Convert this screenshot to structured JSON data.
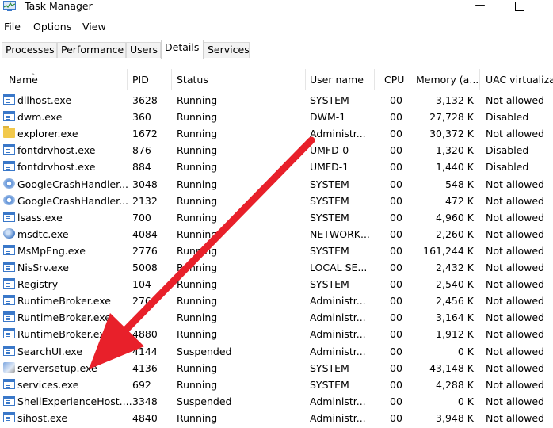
{
  "window": {
    "title": "Task Manager",
    "minimize_glyph": "—"
  },
  "menu": [
    "File",
    "Options",
    "View"
  ],
  "tabs": [
    "Processes",
    "Performance",
    "Users",
    "Details",
    "Services"
  ],
  "active_tab": "Details",
  "columns": {
    "name": "Name",
    "pid": "PID",
    "status": "Status",
    "user": "User name",
    "cpu": "CPU",
    "memory": "Memory (a...",
    "uac": "UAC virtualizat"
  },
  "rows": [
    {
      "icon": "window-icon",
      "name": "dllhost.exe",
      "pid": "3628",
      "status": "Running",
      "user": "SYSTEM",
      "cpu": "00",
      "memory": "3,132 K",
      "uac": "Not allowed"
    },
    {
      "icon": "window-icon",
      "name": "dwm.exe",
      "pid": "360",
      "status": "Running",
      "user": "DWM-1",
      "cpu": "00",
      "memory": "27,728 K",
      "uac": "Disabled"
    },
    {
      "icon": "folder-icon",
      "name": "explorer.exe",
      "pid": "1672",
      "status": "Running",
      "user": "Administr...",
      "cpu": "00",
      "memory": "30,372 K",
      "uac": "Not allowed"
    },
    {
      "icon": "window-icon",
      "name": "fontdrvhost.exe",
      "pid": "876",
      "status": "Running",
      "user": "UMFD-0",
      "cpu": "00",
      "memory": "1,320 K",
      "uac": "Disabled"
    },
    {
      "icon": "window-icon",
      "name": "fontdrvhost.exe",
      "pid": "884",
      "status": "Running",
      "user": "UMFD-1",
      "cpu": "00",
      "memory": "1,440 K",
      "uac": "Disabled"
    },
    {
      "icon": "gear-icon",
      "name": "GoogleCrashHandler...",
      "pid": "3048",
      "status": "Running",
      "user": "SYSTEM",
      "cpu": "00",
      "memory": "548 K",
      "uac": "Not allowed"
    },
    {
      "icon": "gear-icon",
      "name": "GoogleCrashHandler...",
      "pid": "2132",
      "status": "Running",
      "user": "SYSTEM",
      "cpu": "00",
      "memory": "472 K",
      "uac": "Not allowed"
    },
    {
      "icon": "window-icon",
      "name": "lsass.exe",
      "pid": "700",
      "status": "Running",
      "user": "SYSTEM",
      "cpu": "00",
      "memory": "4,960 K",
      "uac": "Not allowed"
    },
    {
      "icon": "network-icon",
      "name": "msdtc.exe",
      "pid": "4084",
      "status": "Running",
      "user": "NETWORK...",
      "cpu": "00",
      "memory": "2,260 K",
      "uac": "Not allowed"
    },
    {
      "icon": "window-icon",
      "name": "MsMpEng.exe",
      "pid": "2776",
      "status": "Running",
      "user": "SYSTEM",
      "cpu": "00",
      "memory": "161,244 K",
      "uac": "Not allowed"
    },
    {
      "icon": "window-icon",
      "name": "NisSrv.exe",
      "pid": "5008",
      "status": "Running",
      "user": "LOCAL SE...",
      "cpu": "00",
      "memory": "2,432 K",
      "uac": "Not allowed"
    },
    {
      "icon": "window-icon",
      "name": "Registry",
      "pid": "104",
      "status": "Running",
      "user": "SYSTEM",
      "cpu": "00",
      "memory": "2,540 K",
      "uac": "Not allowed"
    },
    {
      "icon": "window-icon",
      "name": "RuntimeBroker.exe",
      "pid": "276",
      "status": "Running",
      "user": "Administr...",
      "cpu": "00",
      "memory": "2,456 K",
      "uac": "Not allowed"
    },
    {
      "icon": "window-icon",
      "name": "RuntimeBroker.exe",
      "pid": "",
      "status": "Running",
      "user": "Administr...",
      "cpu": "00",
      "memory": "3,164 K",
      "uac": "Not allowed"
    },
    {
      "icon": "window-icon",
      "name": "RuntimeBroker.exe",
      "pid": "4880",
      "status": "Running",
      "user": "Administr...",
      "cpu": "00",
      "memory": "1,912 K",
      "uac": "Not allowed"
    },
    {
      "icon": "window-icon",
      "name": "SearchUI.exe",
      "pid": "4144",
      "status": "Suspended",
      "user": "Administr...",
      "cpu": "00",
      "memory": "0 K",
      "uac": "Not allowed"
    },
    {
      "icon": "setup-icon",
      "name": "serversetup.exe",
      "pid": "4136",
      "status": "Running",
      "user": "SYSTEM",
      "cpu": "00",
      "memory": "43,148 K",
      "uac": "Not allowed"
    },
    {
      "icon": "window-icon",
      "name": "services.exe",
      "pid": "692",
      "status": "Running",
      "user": "SYSTEM",
      "cpu": "00",
      "memory": "4,288 K",
      "uac": "Not allowed"
    },
    {
      "icon": "window-icon",
      "name": "ShellExperienceHost....",
      "pid": "3348",
      "status": "Suspended",
      "user": "Administr...",
      "cpu": "00",
      "memory": "0 K",
      "uac": "Not allowed"
    },
    {
      "icon": "window-icon",
      "name": "sihost.exe",
      "pid": "4840",
      "status": "Running",
      "user": "Administr...",
      "cpu": "00",
      "memory": "3,948 K",
      "uac": "Not allowed"
    }
  ],
  "colors": {
    "arrow": "#e8202a",
    "icon_blue": "#3a78c9"
  }
}
